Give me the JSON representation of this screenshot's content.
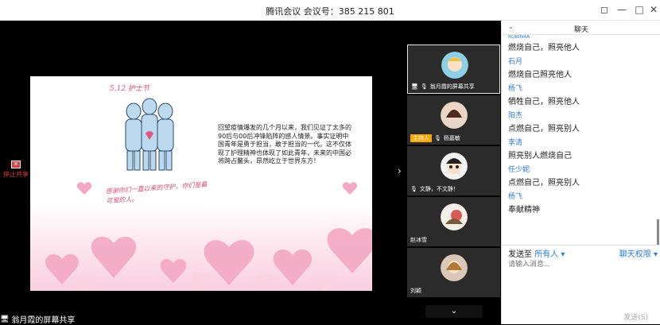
{
  "window": {
    "title": "腾讯会议 会议号：385 215 801"
  },
  "window_controls": {
    "pin": "◻",
    "min": "—",
    "max": "□",
    "close": "✕"
  },
  "share": {
    "stop_label": "停止共享",
    "stop_icon": "✕",
    "sharer_label": "翁月霞的屏幕共享"
  },
  "slide": {
    "caption_top": "5.12 护士节",
    "caption_bottom": "感谢你们一直以来的守护，你们是最可爱的人。",
    "body_text": "回望疫情爆发的几个月以来，我们见证了太多的90后与00后冲锋陷阵的感人情景。事实证明中国青年是勇于担当，敢于担当的一代。这不仅体现了护理精神也体现了如此青年，未来的中国必将跨占鳌头，昂然屹立于世界东方！"
  },
  "participants": [
    {
      "name": "翁月霞的屏幕共享",
      "host": false
    },
    {
      "name": "杨嘉敏",
      "host": true,
      "host_label": "主持人"
    },
    {
      "name": "文静，不文静！",
      "host": false
    },
    {
      "name": "赵冰雪",
      "host": false
    },
    {
      "name": "刘颖",
      "host": false
    }
  ],
  "collapse_icon": "⌄",
  "expand_arrow": "›",
  "chat": {
    "title": "聊天",
    "cut_sender": "ROBIN4A",
    "messages": [
      {
        "sender": "",
        "text": "燃烧自己，照亮他人"
      },
      {
        "sender": "石月",
        "text": "燃烧自己照亮他人"
      },
      {
        "sender": "杨飞",
        "text": "牺牲自己，照亮他人"
      },
      {
        "sender": "阳杰",
        "text": "点燃自己，照亮别人"
      },
      {
        "sender": "李清",
        "text": "照亮别人燃烧自己"
      },
      {
        "sender": "任少妮",
        "text": "点燃自己，照亮别人"
      },
      {
        "sender": "杨飞",
        "text": "奉献精神"
      }
    ],
    "send_to_label": "发送至",
    "send_to_target": "所有人",
    "permission_label": "聊天权限",
    "input_placeholder": "请输入消息...",
    "send_button": "发送(S)"
  }
}
